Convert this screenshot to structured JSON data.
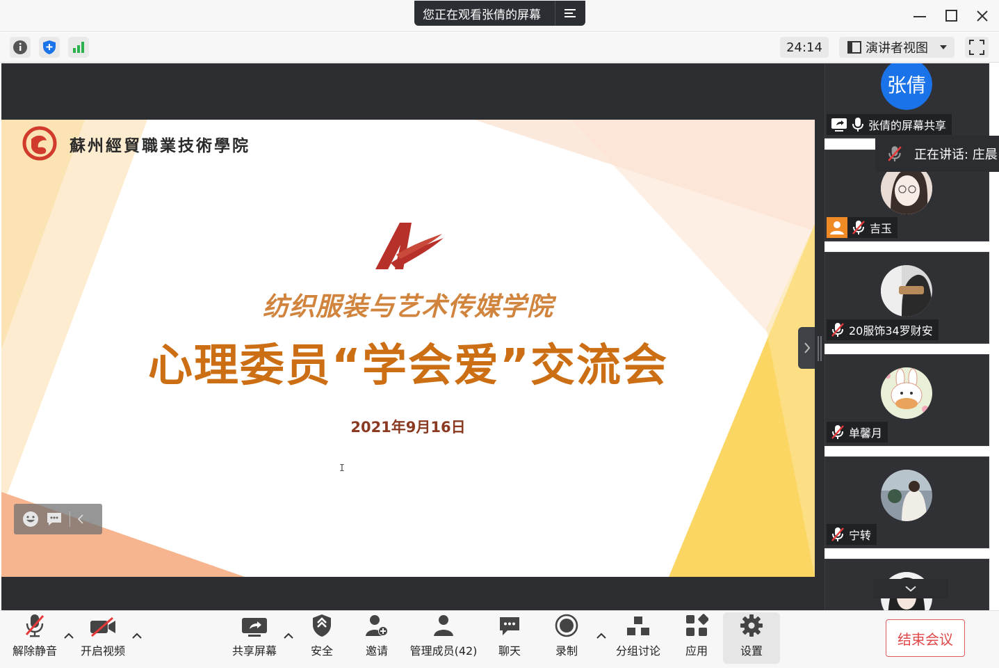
{
  "window": {
    "viewing_banner": "您正在观看张倩的屏幕"
  },
  "toolbar": {
    "timer": "24:14",
    "view_mode": "演讲者视图"
  },
  "slide": {
    "school_name": "蘇州經貿職業技術學院",
    "college": "纺织服装与艺术传媒学院",
    "headline": "心理委员“学会爱”交流会",
    "date": "2021年9月16日",
    "cursor": "I"
  },
  "speaking": {
    "text": "正在讲话: 庄晨"
  },
  "participants": [
    {
      "name": "张倩的屏幕共享",
      "avatar_text": "张倩",
      "muted": false,
      "sharing": true
    },
    {
      "name": "吉玉",
      "muted": true
    },
    {
      "name": "20服饰34罗财安",
      "muted": true
    },
    {
      "name": "单馨月",
      "muted": true
    },
    {
      "name": "宁转",
      "muted": true
    }
  ],
  "bottom": {
    "unmute": "解除静音",
    "video": "开启视频",
    "share": "共享屏幕",
    "security": "安全",
    "invite": "邀请",
    "members": "管理成员(42)",
    "chat": "聊天",
    "record": "录制",
    "breakout": "分组讨论",
    "apps": "应用",
    "settings": "设置",
    "end": "结束会议"
  },
  "colors": {
    "accent_blue": "#1a73e8",
    "end_red": "#e04848",
    "slide_orange": "#cc6e14"
  }
}
